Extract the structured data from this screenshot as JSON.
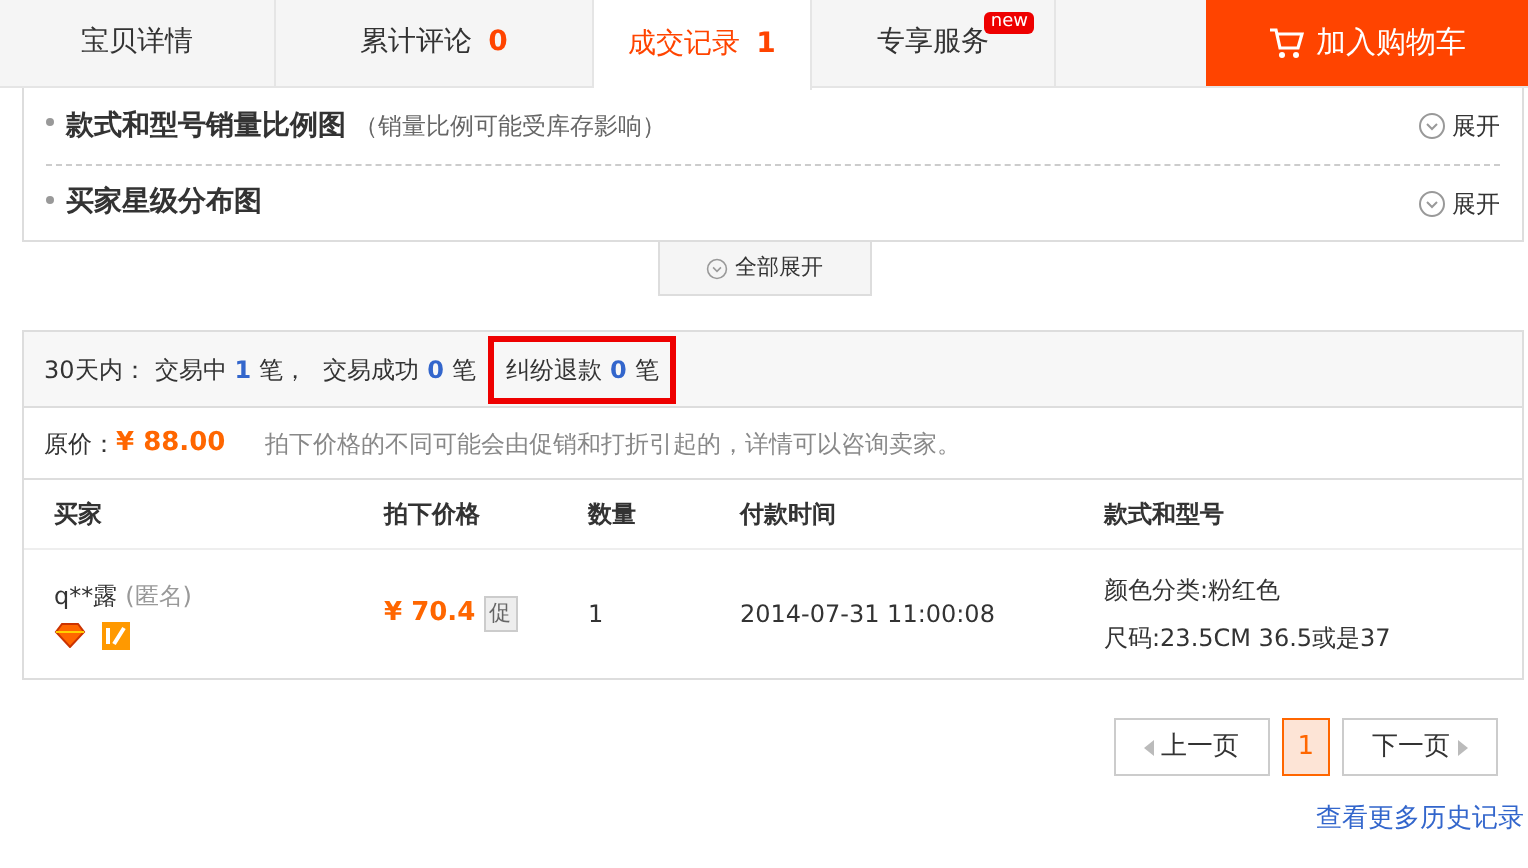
{
  "tabs": [
    {
      "label": "宝贝详情",
      "selected": false
    },
    {
      "label": "累计评论",
      "count": "0",
      "selected": false
    },
    {
      "label": "成交记录",
      "count": "1",
      "selected": true
    },
    {
      "label": "专享服务",
      "badge": "new",
      "selected": false
    }
  ],
  "cart_button": "加入购物车",
  "sections": [
    {
      "title": "款式和型号销量比例图",
      "note": "（销量比例可能受库存影响）",
      "toggle": "展开"
    },
    {
      "title": "买家星级分布图",
      "toggle": "展开"
    }
  ],
  "expand_all": "全部展开",
  "summary": {
    "prefix": "30天内：",
    "items": [
      {
        "label": "交易中",
        "count": "1",
        "unit": "笔，",
        "highlighted": false
      },
      {
        "label": "交易成功",
        "count": "0",
        "unit": "笔",
        "highlighted": false
      },
      {
        "label": "纠纷退款",
        "count": "0",
        "unit": "笔",
        "highlighted": true
      }
    ]
  },
  "original_price": {
    "label": "原价：",
    "value": "¥ 88.00",
    "note": "拍下价格的不同可能会由促销和打折引起的，详情可以咨询卖家。"
  },
  "table": {
    "columns": [
      "买家",
      "拍下价格",
      "数量",
      "付款时间",
      "款式和型号"
    ],
    "rows": [
      {
        "buyer": "q**露",
        "anonymous": "(匿名)",
        "price": "¥ 70.4",
        "promo": "促",
        "quantity": "1",
        "paid_at": "2014-07-31 11:00:08",
        "specs": [
          "颜色分类:粉红色",
          "尺码:23.5CM 36.5或是37"
        ]
      }
    ]
  },
  "pagination": {
    "prev": "上一页",
    "pages": [
      {
        "label": "1",
        "selected": true
      }
    ],
    "next": "下一页"
  },
  "history_link": "查看更多历史记录"
}
